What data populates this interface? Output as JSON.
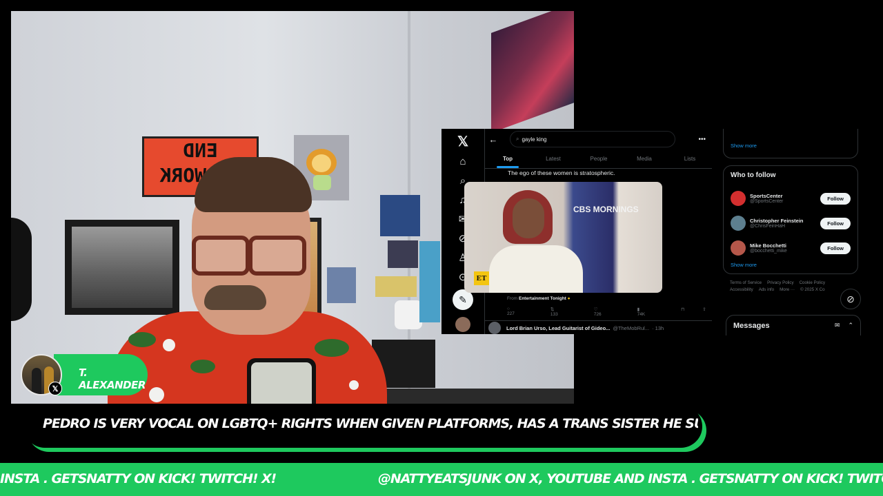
{
  "webcam": {
    "sign_text_top": "END",
    "sign_text_bottom": "AD WORK"
  },
  "x_app": {
    "nav_icons": [
      "x-logo-icon",
      "home-icon",
      "search-icon",
      "notifications-icon",
      "messages-icon",
      "grok-icon",
      "profile-icon",
      "more-icon",
      "post-icon"
    ],
    "back_label": "←",
    "search_value": "gayle king",
    "more_label": "•••",
    "tabs": [
      {
        "label": "Top",
        "active": true
      },
      {
        "label": "Latest",
        "active": false
      },
      {
        "label": "People",
        "active": false
      },
      {
        "label": "Media",
        "active": false
      },
      {
        "label": "Lists",
        "active": false
      }
    ],
    "tweet": {
      "text": "The ego of these women is stratospheric.",
      "media_badge": "ET",
      "media_logo": "CBS MORNINGS",
      "from_prefix": "From",
      "from_source": "Entertainment Tonight",
      "replies": "227",
      "reposts": "133",
      "likes": "726",
      "views": "74K"
    },
    "next_tweet": {
      "name": "Lord Brian Urso, Lead Guitarist of Gideo...",
      "handle": "@TheMobRul...",
      "time": "· 13h"
    }
  },
  "sidebar": {
    "show_more_trends": "Show more",
    "who_to_follow_title": "Who to follow",
    "follow_suggestions": [
      {
        "name": "SportsCenter",
        "handle": "@SportsCenter",
        "button": "Follow",
        "avatar_color": "#d32f2f"
      },
      {
        "name": "Christopher Feinstein",
        "handle": "@ChrisFeinHaH",
        "button": "Follow",
        "avatar_color": "#5d7f8f"
      },
      {
        "name": "Mike Bocchetti",
        "handle": "@bocchetti_mike",
        "button": "Follow",
        "avatar_color": "#b5574a"
      }
    ],
    "show_more_follow": "Show more",
    "footer_links": [
      "Terms of Service",
      "Privacy Policy",
      "Cookie Policy",
      "Accessibility",
      "Ads info",
      "More ···",
      "© 2025 X Co"
    ],
    "messages_title": "Messages"
  },
  "overlay": {
    "name_tag": "T. ALEXANDER",
    "ticker_message": "PEDRO IS VERY VOCAL ON LGBTQ+ RIGHTS WHEN GIVEN PLATFORMS, HAS A TRANS SISTER HE SUPPORTS VERY NICELY.",
    "crawl_segment_a": "INSTA .  GETSNATTY ON KICK! TWITCH! X!",
    "crawl_segment_b": "@NATTYEATSJUNK ON X, YOUTUBE AND INSTA .  GETSNATTY ON KICK! TWITCH! X!",
    "brand_color": "#1ec95e"
  }
}
